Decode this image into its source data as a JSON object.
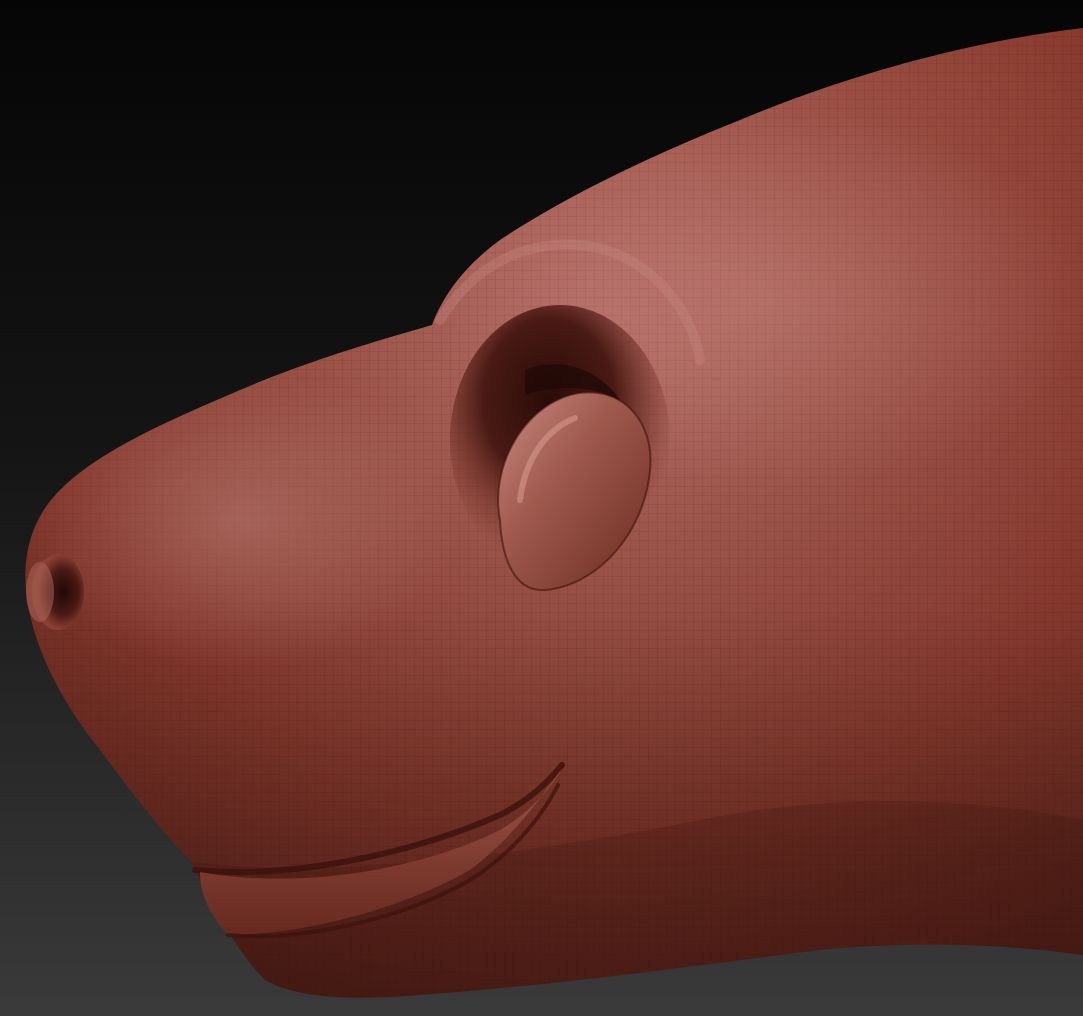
{
  "scene": {
    "subject": "sculpted-animal-head",
    "view": "side-profile-facing-left",
    "colors": {
      "background_top": "#050505",
      "background_bottom": "#3a3a3a",
      "clay_base": "#8a3a2e",
      "clay_highlight": "#b8706a",
      "clay_shadow": "#4a1a14",
      "clay_mid": "#9c4a3c"
    }
  }
}
